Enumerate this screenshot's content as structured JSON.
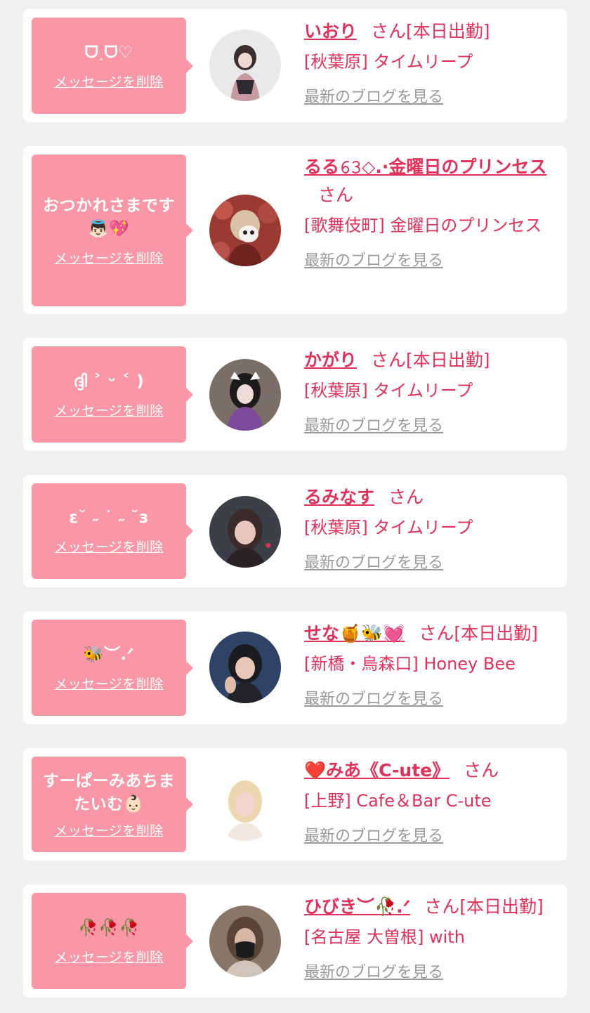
{
  "common": {
    "delete_label": "メッセージを削除",
    "blog_label": "最新のブログを見る",
    "san_suffix": "さん"
  },
  "cards": [
    {
      "message": "ᗜ˰ᗜ♡",
      "name": "いおり",
      "status": "[本日出勤]",
      "shop": "[秋葉原] タイムリープ",
      "avatar_colors": [
        "#e9e9ec",
        "#3a2e2e",
        "#c79aa0"
      ]
    },
    {
      "message": "おつかれさまです👼🏻💖",
      "name": "るる𝟼𝟹◇.·金曜日のプリンセス",
      "status": "",
      "shop": "[歌舞伎町] 金曜日のプリンセス",
      "avatar_colors": [
        "#9a3a33",
        "#d9c2a8",
        "#6e2320"
      ]
    },
    {
      "message": "ദ്ദി ˃ ᵕ ˂ )",
      "name": "かがり",
      "status": "[本日出勤]",
      "shop": "[秋葉原] タイムリープ",
      "avatar_colors": [
        "#7b6e66",
        "#1d1a1c",
        "#7d4a9b"
      ]
    },
    {
      "message": "ε˘ ˶ ˙ ˶ ˘з",
      "name": "るみなす",
      "status": "",
      "shop": "[秋葉原] タイムリープ",
      "avatar_colors": [
        "#3b4048",
        "#e8c6bd",
        "#3a2b2a"
      ]
    },
    {
      "message": "🐝︶.ᐟ",
      "name": "せな🍯🐝💓",
      "status": "[本日出勤]",
      "shop": "[新橋・烏森口] Honey Bee",
      "avatar_colors": [
        "#2f4366",
        "#1b1b22",
        "#e9c7b8"
      ]
    },
    {
      "message": "すーぱーみあちまたいむ👶🏻",
      "name": "❤️みあ《C-ute》",
      "status": "",
      "shop": "[上野] Cafe＆Bar C-ute",
      "avatar_colors": [
        "#ffffff",
        "#ecd6b0",
        "#f0d6cf"
      ]
    },
    {
      "message": "🥀🥀🥀",
      "name": "ひびき︶🥀.ᐟ",
      "status": "[本日出勤]",
      "shop": "[名古屋 大曽根] with",
      "avatar_colors": [
        "#8a7668",
        "#1c1c1e",
        "#d7b8a6"
      ]
    }
  ]
}
